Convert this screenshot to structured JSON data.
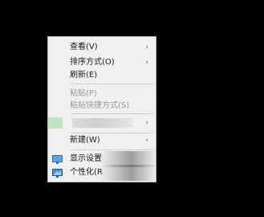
{
  "context_menu": {
    "items": [
      {
        "label": "查看(V)",
        "has_submenu": true,
        "enabled": true
      },
      {
        "label": "排序方式(O)",
        "has_submenu": true,
        "enabled": true
      },
      {
        "label": "刷新(E)",
        "has_submenu": false,
        "enabled": true
      },
      {
        "label": "粘贴(P)",
        "has_submenu": false,
        "enabled": false
      },
      {
        "label": "粘贴快捷方式(S)",
        "has_submenu": false,
        "enabled": false
      },
      {
        "label": "",
        "has_submenu": true,
        "enabled": true
      },
      {
        "label": "新建(W)",
        "has_submenu": true,
        "enabled": true
      },
      {
        "label": "显示设置",
        "icon": "display-settings-icon",
        "has_submenu": false,
        "enabled": true
      },
      {
        "label": "个性化(R",
        "icon": "personalize-icon",
        "has_submenu": false,
        "enabled": true
      }
    ],
    "submenu_arrow": "›"
  },
  "colors": {
    "desktop_background": "#000000",
    "menu_background": "#f0f0f0",
    "disabled_text": "#9a9a9a",
    "separator": "#d2d2d2",
    "icon_accent": "#2d7fd0"
  }
}
